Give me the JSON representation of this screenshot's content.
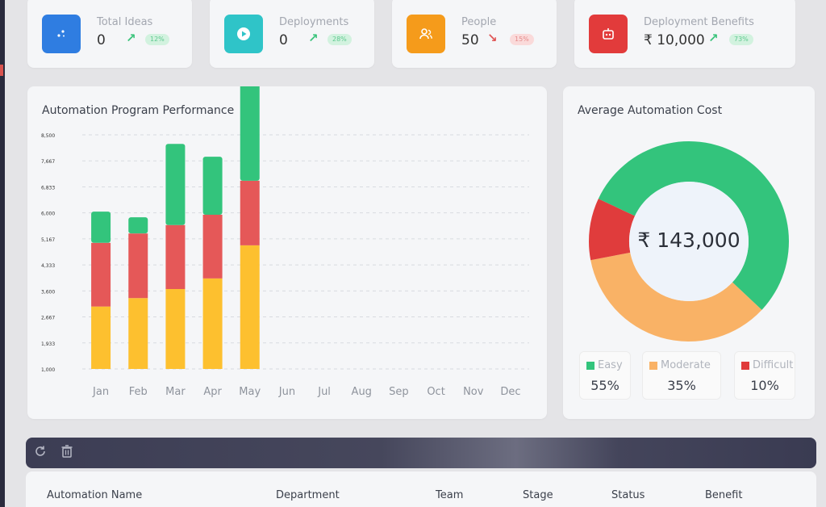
{
  "stats": [
    {
      "label": "Total Ideas",
      "value": "0",
      "trend": "12%",
      "direction": "up",
      "icon": "sparkle-icon",
      "color": "#2f7de1"
    },
    {
      "label": "Deployments",
      "value": "0",
      "trend": "28%",
      "direction": "up",
      "icon": "play-circle-icon",
      "color": "#2fc4c8"
    },
    {
      "label": "People",
      "value": "50",
      "trend": "15%",
      "direction": "down",
      "icon": "people-icon",
      "color": "#f59b1b"
    },
    {
      "label": "Deployment Benefits",
      "value": "₹ 10,000",
      "trend": "73%",
      "direction": "up",
      "icon": "robot-icon",
      "color": "#e23b3b"
    }
  ],
  "performance": {
    "title": "Automation Program Performance"
  },
  "chart_data": [
    {
      "type": "bar",
      "stacked": true,
      "title": "Automation Program Performance",
      "categories": [
        "Jan",
        "Feb",
        "Mar",
        "Apr",
        "May",
        "Jun",
        "Jul",
        "Aug",
        "Sep",
        "Oct",
        "Nov",
        "Dec"
      ],
      "yticks": [
        "1,000",
        "1,933",
        "2,667",
        "3,600",
        "4,333",
        "5,167",
        "6,000",
        "6,833",
        "7,667",
        "8,500"
      ],
      "ylim": [
        1000,
        8500
      ],
      "grid": true,
      "series": [
        {
          "name": "Easy",
          "color": "#fdc02f",
          "values": [
            2000,
            2270,
            2560,
            2900,
            3960,
            null,
            null,
            null,
            null,
            null,
            null,
            null
          ]
        },
        {
          "name": "Difficult",
          "color": "#e55858",
          "values": [
            2040,
            2070,
            2050,
            2040,
            2070,
            null,
            null,
            null,
            null,
            null,
            null,
            null
          ]
        },
        {
          "name": "Moderate",
          "color": "#33c47c",
          "values": [
            1000,
            520,
            2600,
            1860,
            3200,
            null,
            null,
            null,
            null,
            null,
            null,
            null
          ]
        }
      ]
    },
    {
      "type": "pie",
      "title": "Average Automation Cost",
      "center_label": "₹ 143,000",
      "labels": [
        "Easy",
        "Moderate",
        "Difficult"
      ],
      "values": [
        55,
        35,
        10
      ],
      "colors": [
        "#33c47c",
        "#f9b266",
        "#e03c3c"
      ]
    }
  ],
  "cost": {
    "title": "Average Automation Cost",
    "center_label": "₹ 143,000",
    "legend": [
      {
        "name": "Easy",
        "percent": "55%",
        "color": "#33c47c"
      },
      {
        "name": "Moderate",
        "percent": "35%",
        "color": "#f9b266"
      },
      {
        "name": "Difficult",
        "percent": "10%",
        "color": "#e03c3c"
      }
    ]
  },
  "toolbar": {
    "refresh_icon": "refresh-icon",
    "delete_icon": "trash-icon"
  },
  "table": {
    "columns": [
      "Automation Name",
      "Department",
      "Team",
      "Stage",
      "Status",
      "Benefit"
    ]
  }
}
